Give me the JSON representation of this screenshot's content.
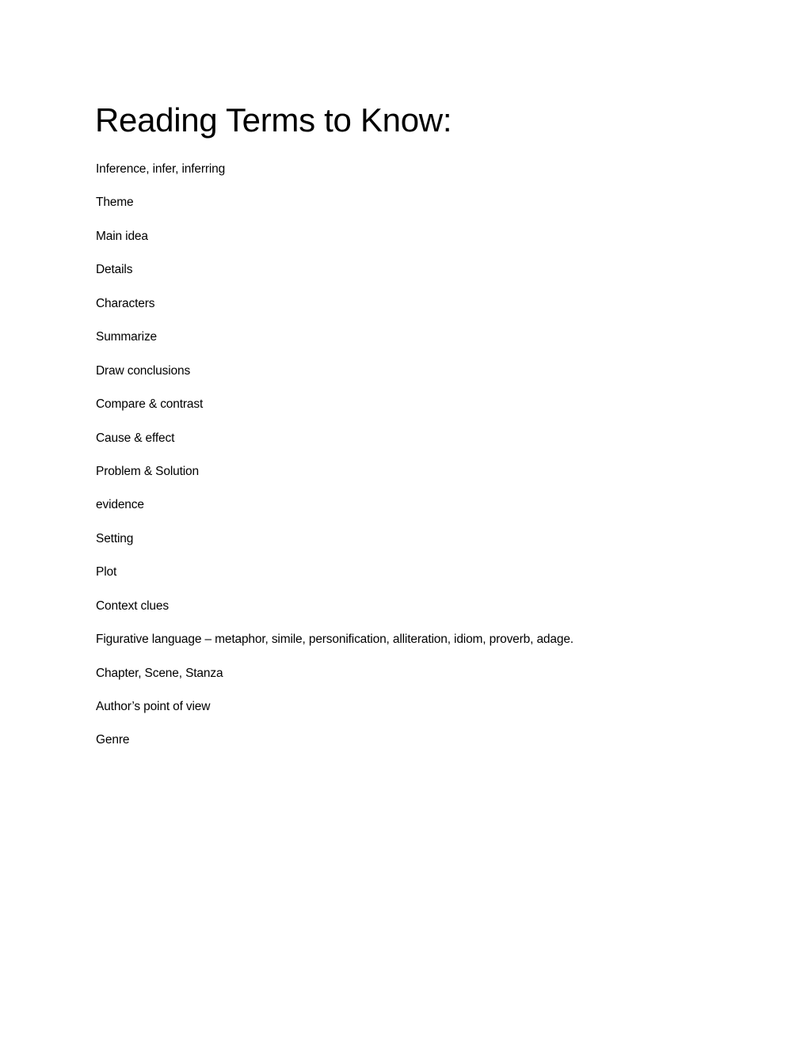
{
  "document": {
    "title": "Reading Terms to Know:",
    "terms": [
      "Inference, infer, inferring",
      "Theme",
      "Main idea",
      "Details",
      "Characters",
      "Summarize",
      "Draw conclusions",
      "Compare & contrast",
      "Cause & effect",
      "Problem & Solution",
      "evidence",
      "Setting",
      "Plot",
      "Context clues",
      "Figurative language – metaphor, simile, personification, alliteration, idiom, proverb, adage.",
      "Chapter, Scene, Stanza",
      "Author’s point of view",
      "Genre"
    ]
  }
}
